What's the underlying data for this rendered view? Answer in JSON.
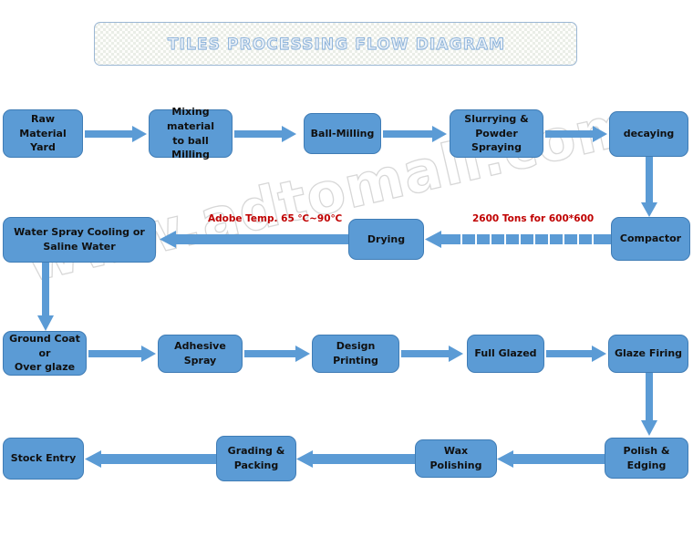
{
  "diagram": {
    "title": "TILES PROCESSING FLOW DIAGRAM",
    "watermark": "www.adtomall.com",
    "colors": {
      "node_fill": "#5B9BD5",
      "node_border": "#3F7CB5",
      "arrow": "#5B9BD5",
      "annotation": "#C00000",
      "title_outline": "#8FB4DA",
      "background": "#FFFFFF"
    },
    "nodes": [
      {
        "id": "raw-material-yard",
        "label": "Raw Material\nYard"
      },
      {
        "id": "mixing-material",
        "label": "Mixing material\nto ball Milling"
      },
      {
        "id": "ball-milling",
        "label": "Ball-Milling"
      },
      {
        "id": "slurrying-powder-spraying",
        "label": "Slurrying &\nPowder Spraying"
      },
      {
        "id": "decaying",
        "label": "decaying"
      },
      {
        "id": "compactor",
        "label": "Compactor"
      },
      {
        "id": "drying",
        "label": "Drying"
      },
      {
        "id": "water-spray-cooling",
        "label": "Water Spray Cooling or\nSaline Water"
      },
      {
        "id": "ground-coat",
        "label": "Ground Coat or\nOver glaze"
      },
      {
        "id": "adhesive-spray",
        "label": "Adhesive Spray"
      },
      {
        "id": "design-printing",
        "label": "Design Printing"
      },
      {
        "id": "full-glazed",
        "label": "Full Glazed"
      },
      {
        "id": "glaze-firing",
        "label": "Glaze Firing"
      },
      {
        "id": "polish-edging",
        "label": "Polish & Edging"
      },
      {
        "id": "wax-polishing",
        "label": "Wax Polishing"
      },
      {
        "id": "grading-packing",
        "label": "Grading &\nPacking"
      },
      {
        "id": "stock-entry",
        "label": "Stock Entry"
      }
    ],
    "annotations": [
      {
        "id": "adobe-temp",
        "text": "Adobe Temp. 65 ℃~90℃"
      },
      {
        "id": "compactor-tonnage",
        "text": "2600 Tons for 600*600"
      }
    ]
  }
}
